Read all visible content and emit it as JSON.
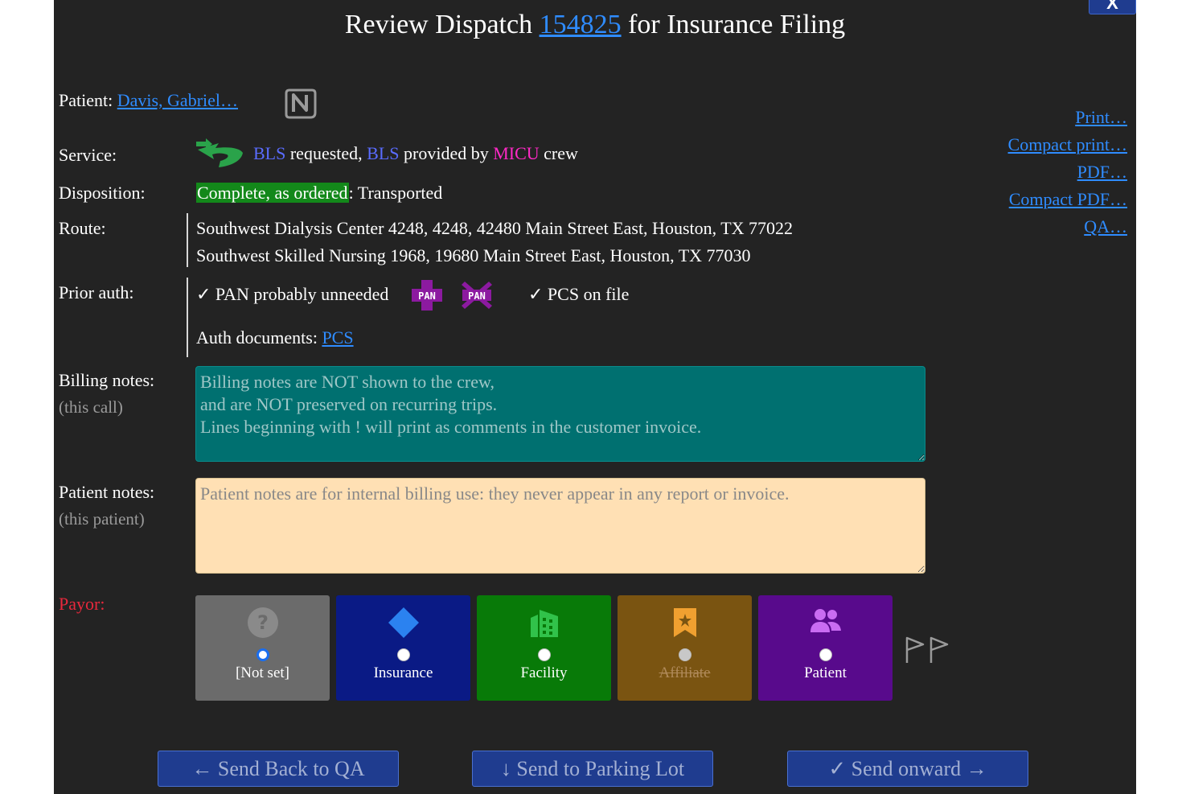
{
  "title": {
    "prefix": "Review Dispatch",
    "dispatch_id": "154825",
    "suffix": "for Insurance Filing"
  },
  "close_label": "X",
  "patient": {
    "label": "Patient:",
    "name": "Davis, Gabriel…",
    "badge_icon": "n-letter-badge-icon"
  },
  "service": {
    "label": "Service:",
    "icon": "ambulance-arrow-icon",
    "requested": "BLS",
    "requested_text": "requested,",
    "provided": "BLS",
    "provided_text": "provided by",
    "crew": "MICU",
    "crew_text": "crew"
  },
  "disposition": {
    "label": "Disposition:",
    "status": "Complete, as ordered",
    "detail": ": Transported"
  },
  "route": {
    "label": "Route:",
    "lines": [
      "Southwest Dialysis Center 4248, 4248, 42480 Main Street East, Houston, TX 77022",
      "Southwest Skilled Nursing 1968, 19680 Main Street East, Houston, TX 77030"
    ]
  },
  "prior_auth": {
    "label": "Prior auth:",
    "pan_status": "✓ PAN probably unneeded",
    "pan_badge_add": "PAN",
    "pan_badge_remove": "PAN",
    "pcs_status": "✓ PCS on file",
    "docs_label": "Auth documents:",
    "docs_link": "PCS"
  },
  "billing_notes": {
    "label": "Billing notes:",
    "sublabel": "(this call)",
    "placeholder": "Billing notes are NOT shown to the crew,\nand are NOT preserved on recurring trips.\nLines beginning with ! will print as comments in the customer invoice."
  },
  "patient_notes": {
    "label": "Patient notes:",
    "sublabel": "(this patient)",
    "placeholder": "Patient notes are for internal billing use: they never appear in any report or invoice."
  },
  "payor": {
    "label": "Payor:",
    "label_color": "#e8283c",
    "options": [
      {
        "label": "[Not set]",
        "icon": "question-circle-icon",
        "color": "#6b6b6b",
        "selected": true
      },
      {
        "label": "Insurance",
        "icon": "diamond-icon",
        "color": "#0a1a85",
        "selected": false
      },
      {
        "label": "Facility",
        "icon": "building-icon",
        "color": "#087a08",
        "selected": false
      },
      {
        "label": "Affiliate",
        "icon": "bookmark-star-icon",
        "color": "#7a5411",
        "selected": false,
        "disabled": true
      },
      {
        "label": "Patient",
        "icon": "people-icon",
        "color": "#580a8c",
        "selected": false
      }
    ],
    "flags_icon": "flags-icon"
  },
  "side_links": [
    "Print…",
    "Compact print…",
    "PDF…",
    "Compact PDF…",
    "QA…"
  ],
  "buttons": {
    "back": "← Send Back to QA",
    "parking": "↓ Send to Parking Lot",
    "onward": "✓ Send onward →"
  }
}
